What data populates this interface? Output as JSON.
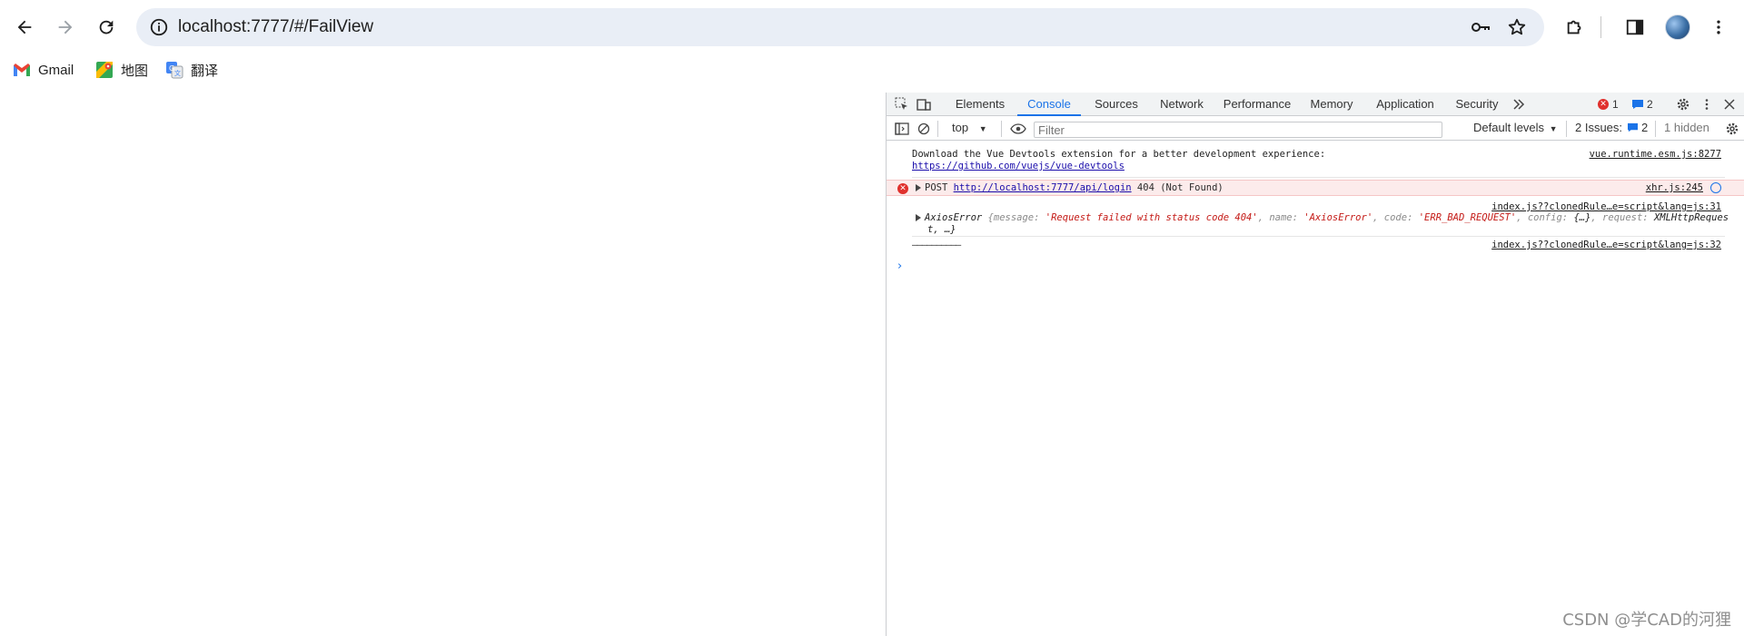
{
  "browser": {
    "url": "localhost:7777/#/FailView"
  },
  "bookmarks": [
    {
      "label": "Gmail"
    },
    {
      "label": "地图"
    },
    {
      "label": "翻译"
    }
  ],
  "devtools": {
    "tabs": [
      {
        "label": "Elements"
      },
      {
        "label": "Console"
      },
      {
        "label": "Sources"
      },
      {
        "label": "Network"
      },
      {
        "label": "Performance"
      },
      {
        "label": "Memory"
      },
      {
        "label": "Application"
      },
      {
        "label": "Security"
      }
    ],
    "active_tab": "Console",
    "error_count": "1",
    "message_count": "2",
    "toolbar": {
      "context": "top",
      "filter_placeholder": "Filter",
      "levels": "Default levels",
      "issues_label": "2 Issues:",
      "issues_count": "2",
      "hidden": "1 hidden"
    },
    "console": {
      "msg1_line1": "Download the Vue Devtools extension for a better development experience:",
      "msg1_link": "https://github.com/vuejs/vue-devtools",
      "msg1_src": "vue.runtime.esm.js:8277",
      "err_method": "POST",
      "err_url": "http://localhost:7777/api/login",
      "err_status": "404 (Not Found)",
      "err_src": "xhr.js:245",
      "axios_src": "index.js??clonedRule…e=script&lang=js:31",
      "axios_name": "AxiosError",
      "axios_k1": "{message:",
      "axios_v1": "'Request failed with status code 404'",
      "axios_k2": ", name:",
      "axios_v2": "'AxiosError'",
      "axios_k3": ", code:",
      "axios_v3": "'ERR_BAD_REQUEST'",
      "axios_k4": ", config:",
      "axios_v4": "{…}",
      "axios_k5": ", request:",
      "axios_v5": "XMLHttpReques",
      "axios_line2": "t,  …}",
      "line3_text": "——————————",
      "line3_src": "index.js??clonedRule…e=script&lang=js:32"
    }
  },
  "watermark": "CSDN @学CAD的河狸",
  "colors": {
    "omnibox_bg": "#e9eef6",
    "devtools_accent": "#1a73e8",
    "error_red": "#e0302c",
    "error_row_bg": "#fcebeb"
  }
}
